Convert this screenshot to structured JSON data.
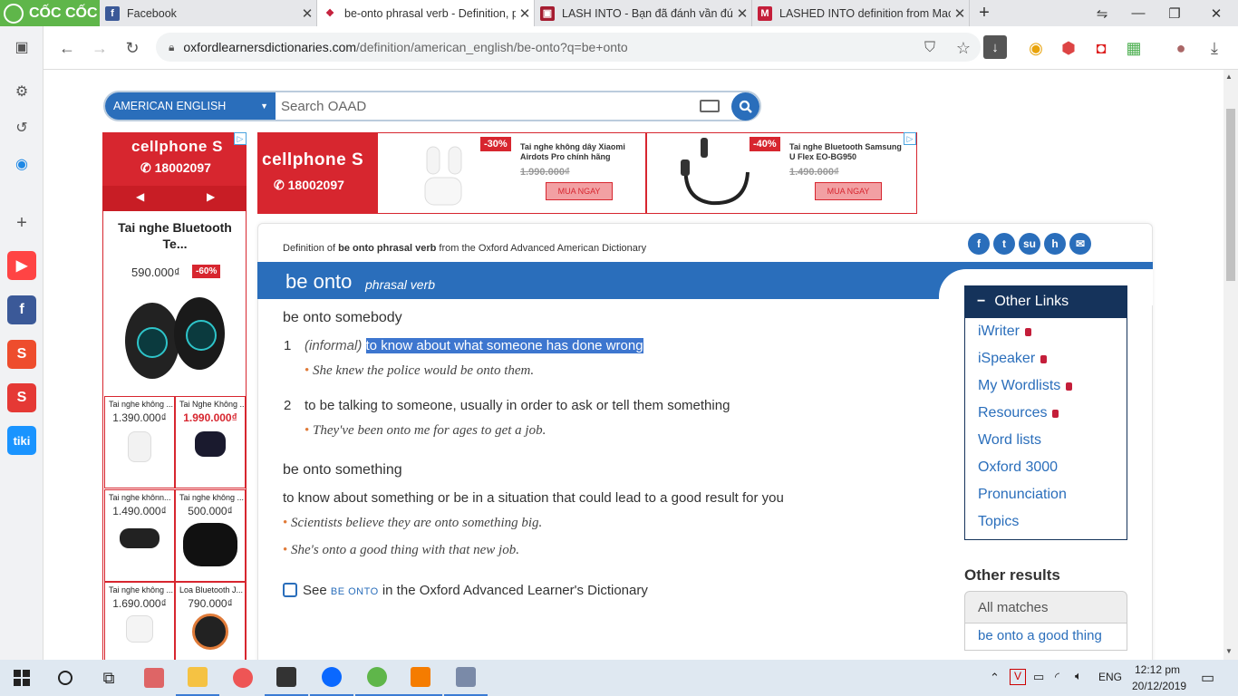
{
  "browser": {
    "name": "CỐC CỐC",
    "tabs": [
      {
        "title": "Facebook",
        "icon": "facebook-icon",
        "active": false
      },
      {
        "title": "be-onto phrasal verb - Definition, pictures, pronunciation",
        "icon": "oxford-icon",
        "active": true
      },
      {
        "title": "LASH INTO - Bạn đã đánh vần đúng",
        "icon": "cambridge-icon",
        "active": false
      },
      {
        "title": "LASHED INTO definition from Macmillan",
        "icon": "macmillan-icon",
        "active": false
      }
    ],
    "url_domain": "oxfordlearnersdictionaries.com",
    "url_path": "/definition/american_english/be-onto?q=be+onto"
  },
  "search": {
    "dictionary": "AMERICAN ENGLISH",
    "placeholder": "Search OAAD"
  },
  "ads": {
    "brand": "cellphone S",
    "phone": "18002097",
    "left": {
      "title": "Tai nghe Bluetooth Te...",
      "price": "590.000₫",
      "discount": "-60%",
      "cells": [
        {
          "name": "Tai nghe không ...",
          "price": "1.390.000₫",
          "red": false
        },
        {
          "name": "Tai Nghe Không ...",
          "price": "1.990.000₫",
          "red": true
        },
        {
          "name": "Tai nghe khônn...",
          "price": "1.490.000₫",
          "red": false
        },
        {
          "name": "Tai nghe không ...",
          "price": "500.000₫",
          "red": false
        },
        {
          "name": "Tai nghe không ...",
          "price": "1.690.000₫",
          "red": false
        },
        {
          "name": "Loa Bluetooth J...",
          "price": "790.000₫",
          "red": false
        }
      ]
    },
    "top": [
      {
        "discount": "-30%",
        "name": "Tai nghe không dây Xiaomi Airdots Pro chính hãng",
        "old_price": "1.990.000₫",
        "button": "MUA NGAY"
      },
      {
        "discount": "-40%",
        "name": "Tai nghe Bluetooth Samsung U Flex EO-BG950",
        "old_price": "1.490.000₫",
        "button": "MUA NGAY"
      }
    ]
  },
  "entry": {
    "source_prefix": "Definition of ",
    "source_word": "be onto phrasal verb",
    "source_suffix": " from the Oxford Advanced American Dictionary",
    "headword": "be onto",
    "pos": "phrasal verb",
    "senses": [
      {
        "head": "be onto somebody",
        "items": [
          {
            "num": "1",
            "label": "(informal)",
            "def": "to know about what someone has done wrong",
            "example": "She knew the police would be onto them."
          },
          {
            "num": "2",
            "def": "to be talking to someone, usually in order to ask or tell them something",
            "example": "They've been onto me for ages to get a job."
          }
        ]
      },
      {
        "head": "be onto something",
        "def": "to know about something or be in a situation that could lead to a good result for you",
        "examples": [
          "Scientists believe they are onto something big.",
          "She's onto a good thing with that new job."
        ]
      }
    ],
    "see_prefix": "See ",
    "see_word": "BE ONTO",
    "see_suffix": " in the Oxford Advanced Learner's Dictionary"
  },
  "sidebar": {
    "other_links_title": "Other Links",
    "links": [
      {
        "label": "iWriter",
        "locked": true
      },
      {
        "label": "iSpeaker",
        "locked": true
      },
      {
        "label": "My Wordlists",
        "locked": true
      },
      {
        "label": "Resources",
        "locked": true
      },
      {
        "label": "Word lists",
        "locked": false
      },
      {
        "label": "Oxford 3000",
        "locked": false
      },
      {
        "label": "Pronunciation",
        "locked": false
      },
      {
        "label": "Topics",
        "locked": false
      }
    ],
    "other_results_title": "Other results",
    "all_matches": "All matches",
    "match1": "be onto a good thing"
  },
  "taskbar": {
    "language": "ENG",
    "time": "12:12 pm",
    "date": "20/12/2019"
  },
  "colors": {
    "oxford_blue": "#2a6ebb",
    "dark_navy": "#15335b",
    "ad_red": "#d7262f",
    "highlight": "#3d76cf"
  }
}
